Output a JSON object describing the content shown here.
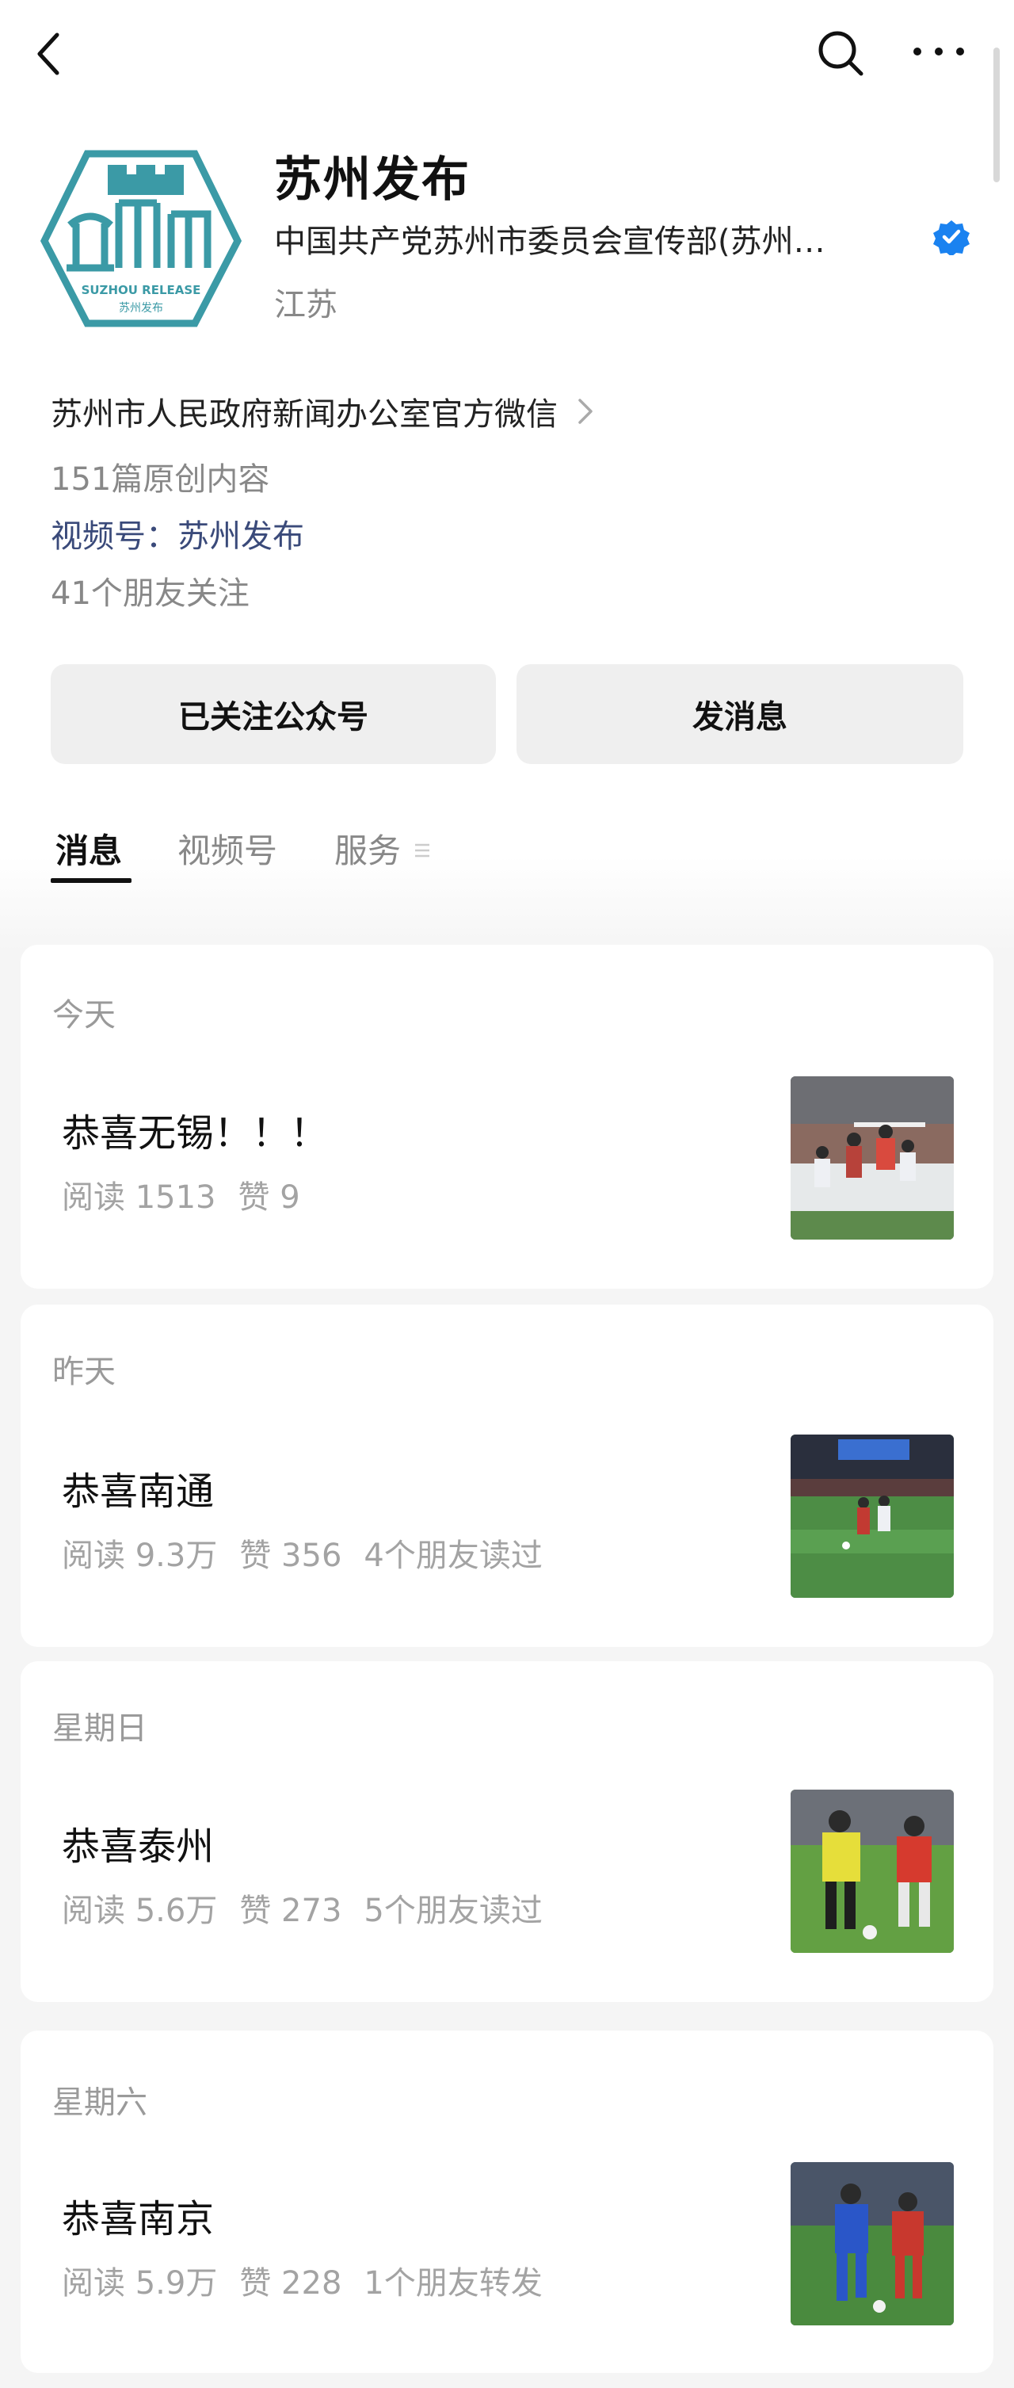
{
  "account": {
    "name": "苏州发布",
    "org": "中国共产党苏州市委员会宣传部(苏州…",
    "region": "江苏",
    "intro": "苏州市人民政府新闻办公室官方微信",
    "original_count": "151篇原创内容",
    "channel_label": "视频号：",
    "channel_name": "苏州发布",
    "friends_following": "41个朋友关注",
    "logo_text_en": "SUZHOU RELEASE",
    "logo_text_cn": "苏州发布"
  },
  "actions": {
    "follow_label": "已关注公众号",
    "message_label": "发消息"
  },
  "tabs": [
    {
      "label": "消息",
      "active": true
    },
    {
      "label": "视频号",
      "active": false
    },
    {
      "label": "服务",
      "active": false
    }
  ],
  "articles": [
    {
      "day": "今天",
      "title": "恭喜无锡！！！",
      "reads": "阅读 1513",
      "likes": "赞 9",
      "social": "",
      "thumb_icon": "soccer-header-photo"
    },
    {
      "day": "昨天",
      "title": "恭喜南通",
      "reads": "阅读 9.3万",
      "likes": "赞 356",
      "social": "4个朋友读过",
      "thumb_icon": "soccer-field-photo"
    },
    {
      "day": "星期日",
      "title": "恭喜泰州",
      "reads": "阅读 5.6万",
      "likes": "赞 273",
      "social": "5个朋友读过",
      "thumb_icon": "soccer-duel-photo"
    },
    {
      "day": "星期六",
      "title": "恭喜南京",
      "reads": "阅读 5.9万",
      "likes": "赞 228",
      "social": "1个朋友转发",
      "thumb_icon": "soccer-dribble-photo"
    }
  ],
  "colors": {
    "verified": "#1a82f0",
    "logo": "#3b9aa6",
    "channel_link": "#3a4a7a"
  },
  "icons": [
    "back-arrow-icon",
    "search-icon",
    "more-icon",
    "verified-badge-icon",
    "chevron-right-icon",
    "menu-icon"
  ]
}
